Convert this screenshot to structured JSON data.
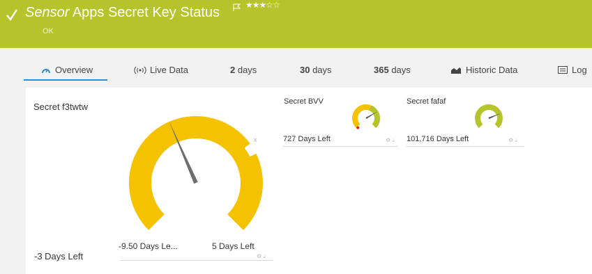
{
  "header": {
    "title_italic": "Sensor",
    "title_rest": " Apps Secret Key Status",
    "stars": "★★★☆☆",
    "status": "OK",
    "bg_color": "#b6c42b"
  },
  "tabs": [
    {
      "label": "Overview",
      "icon": "gauge-icon"
    },
    {
      "label": "Live Data",
      "icon": "live-data-icon"
    },
    {
      "num": "2",
      "unit": " days"
    },
    {
      "num": "30",
      "unit": " days"
    },
    {
      "num": "365",
      "unit": " days"
    },
    {
      "label": "Historic Data",
      "icon": "historic-chart-icon"
    },
    {
      "label": "Log",
      "icon": "log-icon"
    }
  ],
  "gauges": {
    "main": {
      "title": "Secret f3twtw",
      "value_label": "-3 Days Left",
      "min_label": "-9.50 Days Le...",
      "max_label": "5 Days Left",
      "close": "x",
      "level": 0.45,
      "color": "#f5c200"
    },
    "bvv": {
      "title": "Secret BVV",
      "value_label": "727 Days Left",
      "level": 0.72,
      "color": "#f5c200",
      "ok_color": "#b6c42b"
    },
    "fafaf": {
      "title": "Secret fafaf",
      "value_label": "101,716 Days Left",
      "level": 0.75,
      "color": "#b6c42b"
    },
    "controls": "⚙ ⤓"
  }
}
